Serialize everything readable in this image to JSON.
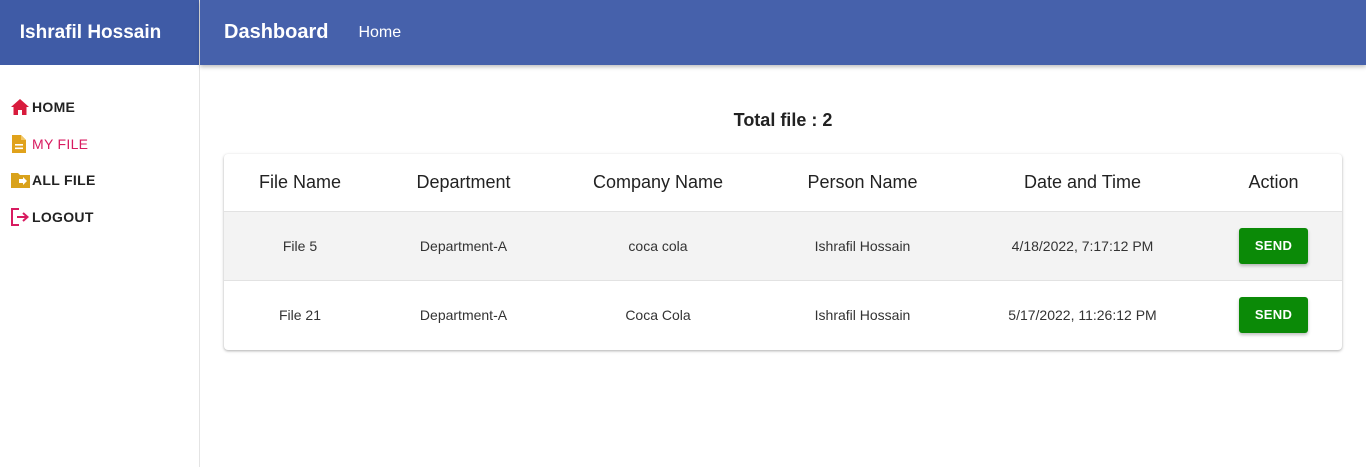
{
  "sidebar": {
    "brand": "Ishrafil Hossain",
    "items": [
      {
        "label": "HOME",
        "icon": "home-icon",
        "active": false,
        "icon_color": "#d81b3c"
      },
      {
        "label": "MY FILE",
        "icon": "file-icon",
        "active": true,
        "icon_color": "#e0a21b"
      },
      {
        "label": "ALL FILE",
        "icon": "folder-icon",
        "active": false,
        "icon_color": "#d9a21b"
      },
      {
        "label": "LOGOUT",
        "icon": "logout-icon",
        "active": false,
        "icon_color": "#d81b60"
      }
    ]
  },
  "header": {
    "title": "Dashboard",
    "home_link": "Home"
  },
  "main": {
    "total_label": "Total file : 2",
    "table": {
      "columns": [
        "File Name",
        "Department",
        "Company Name",
        "Person Name",
        "Date and Time",
        "Action"
      ],
      "rows": [
        {
          "file_name": "File 5",
          "department": "Department-A",
          "company": "coca cola",
          "person": "Ishrafil Hossain",
          "datetime": "4/18/2022, 7:17:12 PM",
          "action": "SEND"
        },
        {
          "file_name": "File 21",
          "department": "Department-A",
          "company": "Coca Cola",
          "person": "Ishrafil Hossain",
          "datetime": "5/17/2022, 11:26:12 PM",
          "action": "SEND"
        }
      ]
    }
  },
  "colors": {
    "header_bg": "#4661ab",
    "brand_bg": "#3f5ba6",
    "active_nav": "#d81b60",
    "send_button": "#0b8a07"
  }
}
